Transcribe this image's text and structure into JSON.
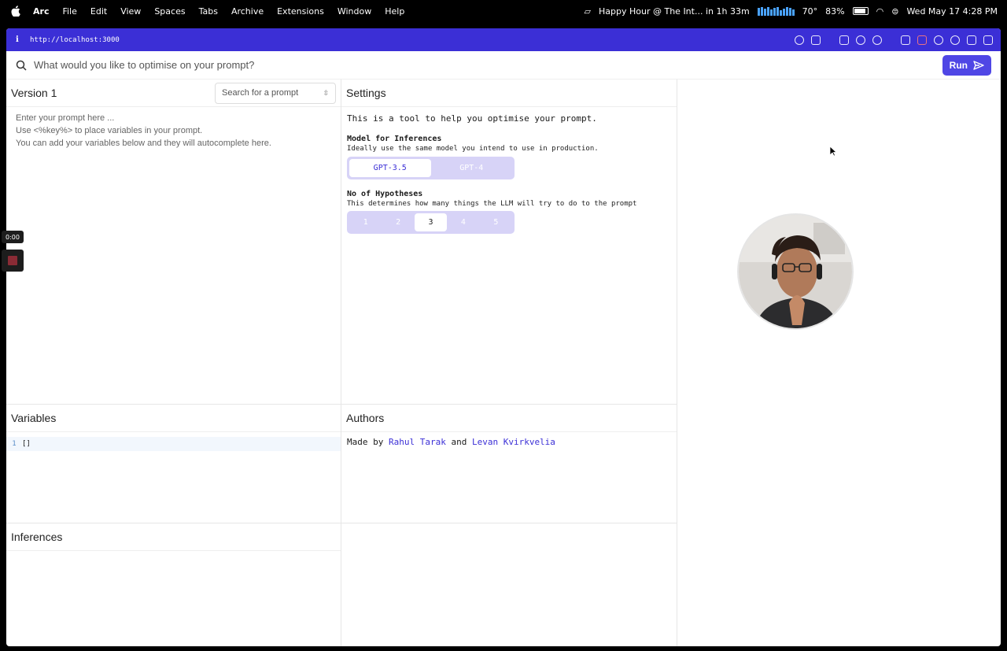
{
  "menubar": {
    "items": [
      "Arc",
      "File",
      "Edit",
      "View",
      "Spaces",
      "Tabs",
      "Archive",
      "Extensions",
      "Window",
      "Help"
    ],
    "event": "Happy Hour @ The Int... in 1h 33m",
    "temperature": "70°",
    "battery": "83%",
    "datetime": "Wed May 17  4:28 PM"
  },
  "browser": {
    "url": "http://localhost:3000"
  },
  "search": {
    "placeholder": "What would you like to optimise on your prompt?",
    "run_label": "Run"
  },
  "prompt_pane": {
    "title": "Version 1",
    "select_placeholder": "Search for a prompt",
    "placeholder_lines": [
      "Enter your prompt here ...",
      "Use <%key%> to place variables in your prompt.",
      "You can add your variables below and they will autocomplete here."
    ]
  },
  "settings": {
    "title": "Settings",
    "description": "This is a tool to help you optimise your prompt.",
    "model": {
      "label": "Model for Inferences",
      "hint": "Ideally use the same model you intend to use in production.",
      "options": [
        "GPT-3.5",
        "GPT-4"
      ],
      "selected": "GPT-3.5"
    },
    "hypotheses": {
      "label": "No of Hypotheses",
      "hint": "This determines how many things the LLM will try to do to the prompt",
      "options": [
        "1",
        "2",
        "3",
        "4",
        "5"
      ],
      "selected": "3"
    }
  },
  "variables": {
    "title": "Variables",
    "line_number": "1",
    "content": "[]"
  },
  "authors": {
    "title": "Authors",
    "prefix": "Made by",
    "author1": "Rahul Tarak",
    "joiner": "and",
    "author2": "Levan Kvirkvelia"
  },
  "inferences": {
    "title": "Inferences"
  },
  "recorder": {
    "time": "0:00"
  },
  "colors": {
    "accent": "#3b2fd6",
    "run_button": "#4f46e5",
    "segment_bg": "#d7d3f7"
  }
}
